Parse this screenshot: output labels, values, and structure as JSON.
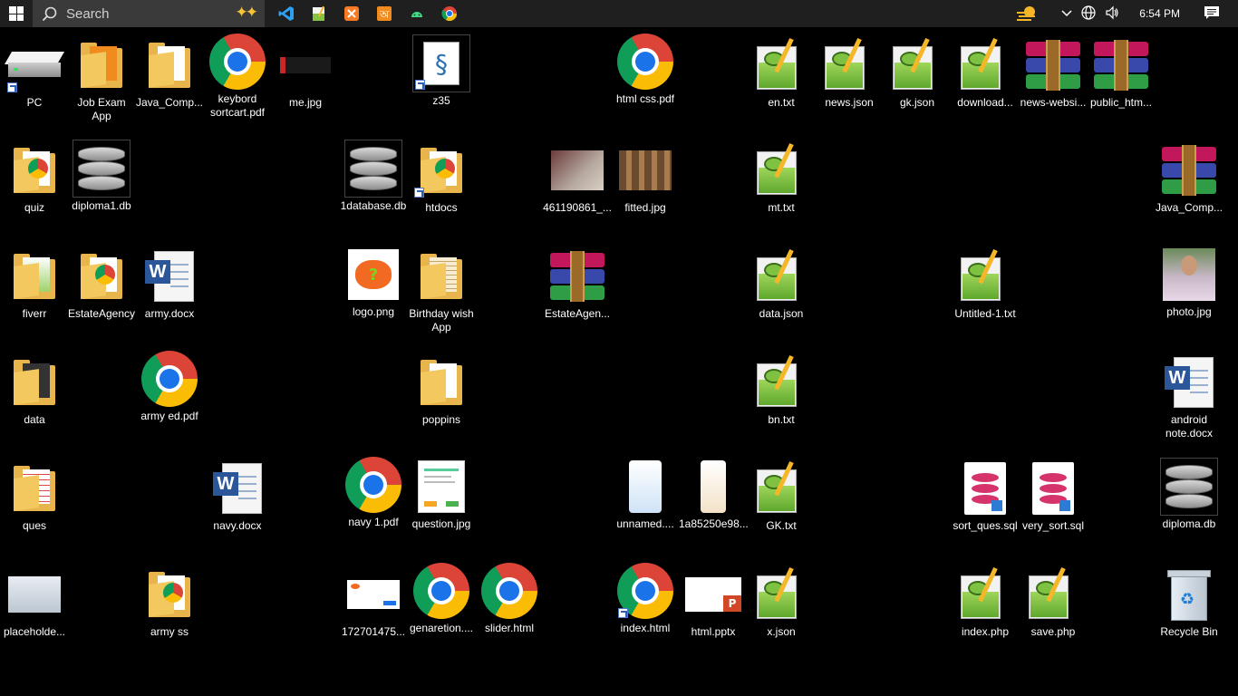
{
  "taskbar": {
    "search_placeholder": "Search",
    "pinned": [
      "vscode-icon",
      "notepad-icon",
      "xampp-icon",
      "bangla-app-icon",
      "android-icon",
      "chrome-icon"
    ],
    "clock": "6:54 PM"
  },
  "icons": {
    "pc": "PC",
    "job_exam_app": "Job Exam App",
    "java_comp_1": "Java_Comp...",
    "keybord_sortcart": "keybord sortcart.pdf",
    "me_jpg": "me.jpg",
    "z35": "z35",
    "html_css_pdf": "html css.pdf",
    "en_txt": "en.txt",
    "news_json": "news.json",
    "gk_json": "gk.json",
    "download": "download...",
    "news_websi": "news-websi...",
    "public_htm": "public_htm...",
    "quiz": "quiz",
    "diploma1_db": "diploma1.db",
    "database1_db": "1database.db",
    "htdocs": "htdocs",
    "img_461190861": "461190861_...",
    "fitted_jpg": "fitted.jpg",
    "mt_txt": "mt.txt",
    "java_comp_2": "Java_Comp...",
    "fiverr": "fiverr",
    "estateagency": "EstateAgency",
    "army_docx": "army.docx",
    "logo_png": "logo.png",
    "birthday_wish": "Birthday wish App",
    "estateagen_zip": "EstateAgen...",
    "data_json": "data.json",
    "untitled_1": "Untitled-1.txt",
    "photo_jpg": "photo.jpg",
    "data": "data",
    "army_ed_pdf": "army ed.pdf",
    "poppins": "poppins",
    "bn_txt": "bn.txt",
    "android_note": "android note.docx",
    "ques": "ques",
    "navy_docx": "navy.docx",
    "navy1_pdf": "navy 1.pdf",
    "question_jpg": "question.jpg",
    "unnamed": "unnamed....",
    "img_1a85250e98": "1a85250e98...",
    "gk_txt": "GK.txt",
    "sort_ques_sql": "sort_ques.sql",
    "very_sort_sql": "very_sort.sql",
    "diploma_db": "diploma.db",
    "placeholde": "placeholde...",
    "army_ss": "army ss",
    "img_172701475": "172701475...",
    "genaretion": "genaretion....",
    "slider_html": "slider.html",
    "index_html": "index.html",
    "html_pptx": "html.pptx",
    "x_json": "x.json",
    "index_php": "index.php",
    "save_php": "save.php",
    "recycle_bin": "Recycle Bin"
  }
}
